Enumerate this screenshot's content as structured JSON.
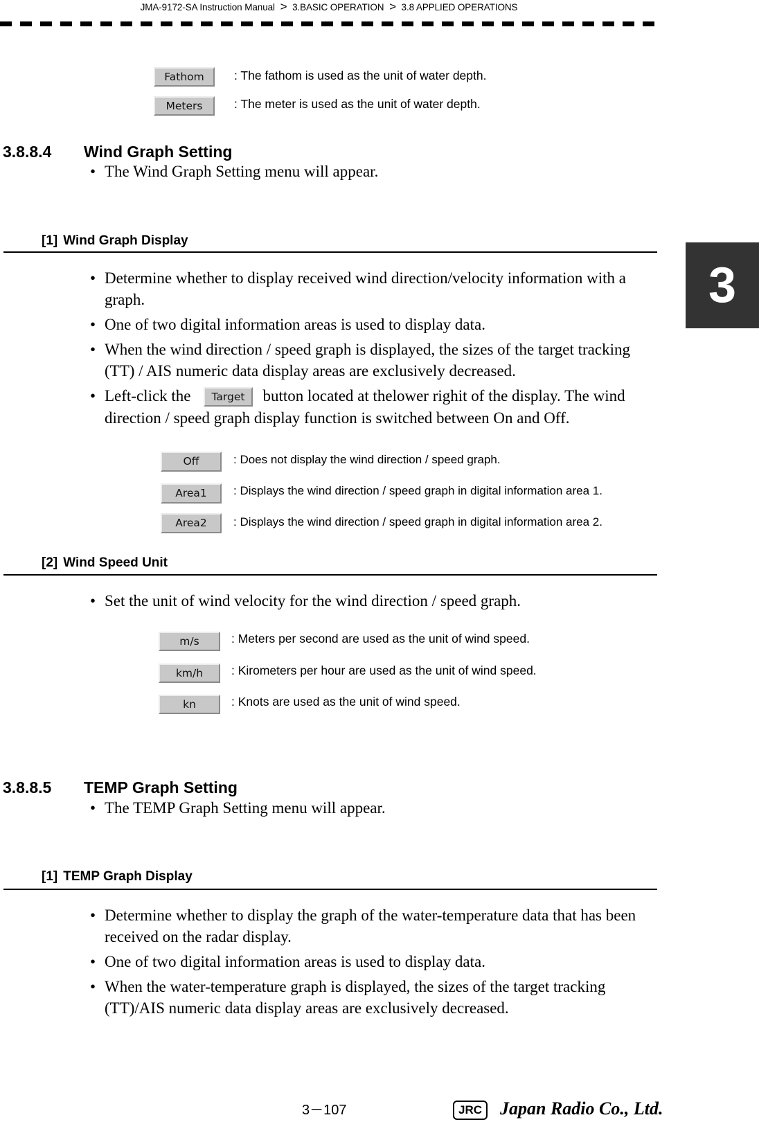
{
  "header": {
    "breadcrumb": [
      "JMA-9172-SA Instruction Manual",
      "3.BASIC OPERATION",
      "3.8  APPLIED OPERATIONS"
    ],
    "separator": ">"
  },
  "chapter_tab": "3",
  "depth_unit_options": [
    {
      "button": "Fathom",
      "description": ": The fathom is used as the unit of water depth."
    },
    {
      "button": "Meters",
      "description": ": The meter is used as the unit of water depth."
    }
  ],
  "section_wind": {
    "number": "3.8.8.4",
    "title": "Wind Graph Setting",
    "intro_bullets": [
      "The Wind Graph Setting menu will appear."
    ],
    "subsections": [
      {
        "index": "[1]",
        "title": "Wind Graph Display",
        "bullets": [
          "Determine whether to display received wind direction/velocity information with a graph.",
          "One of two digital information areas is used to display data.",
          "When the wind direction / speed graph is displayed, the sizes of the target tracking (TT) / AIS numeric data display areas are exclusively decreased."
        ],
        "click_bullet": {
          "before": "Left-click the",
          "button": "Target",
          "after": "button located at thelower righit of the display. The wind direction / speed graph display function is switched between On and Off."
        },
        "options": [
          {
            "button": "Off",
            "description": ": Does not display the wind direction / speed graph."
          },
          {
            "button": "Area1",
            "description": ": Displays the wind direction / speed graph in digital information area 1."
          },
          {
            "button": "Area2",
            "description": ": Displays the wind direction / speed graph in digital information area 2."
          }
        ]
      },
      {
        "index": "[2]",
        "title": "Wind Speed Unit",
        "bullets": [
          "Set the unit of wind velocity for the wind direction / speed graph."
        ],
        "options": [
          {
            "button": "m/s",
            "description": ": Meters per second are used as the unit of wind speed."
          },
          {
            "button": "km/h",
            "description": ": Kirometers per hour are used as the unit of wind speed."
          },
          {
            "button": "kn",
            "description": ": Knots are used as the unit of wind speed."
          }
        ]
      }
    ]
  },
  "section_temp": {
    "number": "3.8.8.5",
    "title": "TEMP Graph Setting",
    "intro_bullets": [
      "The TEMP Graph Setting menu will appear."
    ],
    "subsections": [
      {
        "index": "[1]",
        "title": "TEMP Graph Display",
        "bullets": [
          "Determine whether to display the graph of the water-temperature data that has been received on the radar display.",
          "One of two digital information areas is used to display data.",
          "When the water-temperature graph is displayed, the sizes of the target tracking (TT)/AIS numeric data display areas are exclusively decreased."
        ]
      }
    ]
  },
  "footer": {
    "page_number": "3－107",
    "logo": "JRC",
    "company": "Japan Radio Co., Ltd."
  },
  "bullet_glyph": "•"
}
